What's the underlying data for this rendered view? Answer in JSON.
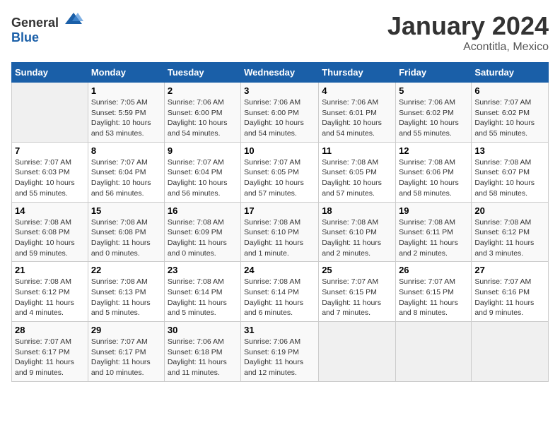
{
  "header": {
    "logo_general": "General",
    "logo_blue": "Blue",
    "month": "January 2024",
    "location": "Acontitla, Mexico"
  },
  "days_of_week": [
    "Sunday",
    "Monday",
    "Tuesday",
    "Wednesday",
    "Thursday",
    "Friday",
    "Saturday"
  ],
  "weeks": [
    [
      {
        "day": "",
        "info": ""
      },
      {
        "day": "1",
        "info": "Sunrise: 7:05 AM\nSunset: 5:59 PM\nDaylight: 10 hours\nand 53 minutes."
      },
      {
        "day": "2",
        "info": "Sunrise: 7:06 AM\nSunset: 6:00 PM\nDaylight: 10 hours\nand 54 minutes."
      },
      {
        "day": "3",
        "info": "Sunrise: 7:06 AM\nSunset: 6:00 PM\nDaylight: 10 hours\nand 54 minutes."
      },
      {
        "day": "4",
        "info": "Sunrise: 7:06 AM\nSunset: 6:01 PM\nDaylight: 10 hours\nand 54 minutes."
      },
      {
        "day": "5",
        "info": "Sunrise: 7:06 AM\nSunset: 6:02 PM\nDaylight: 10 hours\nand 55 minutes."
      },
      {
        "day": "6",
        "info": "Sunrise: 7:07 AM\nSunset: 6:02 PM\nDaylight: 10 hours\nand 55 minutes."
      }
    ],
    [
      {
        "day": "7",
        "info": "Sunrise: 7:07 AM\nSunset: 6:03 PM\nDaylight: 10 hours\nand 55 minutes."
      },
      {
        "day": "8",
        "info": "Sunrise: 7:07 AM\nSunset: 6:04 PM\nDaylight: 10 hours\nand 56 minutes."
      },
      {
        "day": "9",
        "info": "Sunrise: 7:07 AM\nSunset: 6:04 PM\nDaylight: 10 hours\nand 56 minutes."
      },
      {
        "day": "10",
        "info": "Sunrise: 7:07 AM\nSunset: 6:05 PM\nDaylight: 10 hours\nand 57 minutes."
      },
      {
        "day": "11",
        "info": "Sunrise: 7:08 AM\nSunset: 6:05 PM\nDaylight: 10 hours\nand 57 minutes."
      },
      {
        "day": "12",
        "info": "Sunrise: 7:08 AM\nSunset: 6:06 PM\nDaylight: 10 hours\nand 58 minutes."
      },
      {
        "day": "13",
        "info": "Sunrise: 7:08 AM\nSunset: 6:07 PM\nDaylight: 10 hours\nand 58 minutes."
      }
    ],
    [
      {
        "day": "14",
        "info": "Sunrise: 7:08 AM\nSunset: 6:08 PM\nDaylight: 10 hours\nand 59 minutes."
      },
      {
        "day": "15",
        "info": "Sunrise: 7:08 AM\nSunset: 6:08 PM\nDaylight: 11 hours\nand 0 minutes."
      },
      {
        "day": "16",
        "info": "Sunrise: 7:08 AM\nSunset: 6:09 PM\nDaylight: 11 hours\nand 0 minutes."
      },
      {
        "day": "17",
        "info": "Sunrise: 7:08 AM\nSunset: 6:10 PM\nDaylight: 11 hours\nand 1 minute."
      },
      {
        "day": "18",
        "info": "Sunrise: 7:08 AM\nSunset: 6:10 PM\nDaylight: 11 hours\nand 2 minutes."
      },
      {
        "day": "19",
        "info": "Sunrise: 7:08 AM\nSunset: 6:11 PM\nDaylight: 11 hours\nand 2 minutes."
      },
      {
        "day": "20",
        "info": "Sunrise: 7:08 AM\nSunset: 6:12 PM\nDaylight: 11 hours\nand 3 minutes."
      }
    ],
    [
      {
        "day": "21",
        "info": "Sunrise: 7:08 AM\nSunset: 6:12 PM\nDaylight: 11 hours\nand 4 minutes."
      },
      {
        "day": "22",
        "info": "Sunrise: 7:08 AM\nSunset: 6:13 PM\nDaylight: 11 hours\nand 5 minutes."
      },
      {
        "day": "23",
        "info": "Sunrise: 7:08 AM\nSunset: 6:14 PM\nDaylight: 11 hours\nand 5 minutes."
      },
      {
        "day": "24",
        "info": "Sunrise: 7:08 AM\nSunset: 6:14 PM\nDaylight: 11 hours\nand 6 minutes."
      },
      {
        "day": "25",
        "info": "Sunrise: 7:07 AM\nSunset: 6:15 PM\nDaylight: 11 hours\nand 7 minutes."
      },
      {
        "day": "26",
        "info": "Sunrise: 7:07 AM\nSunset: 6:15 PM\nDaylight: 11 hours\nand 8 minutes."
      },
      {
        "day": "27",
        "info": "Sunrise: 7:07 AM\nSunset: 6:16 PM\nDaylight: 11 hours\nand 9 minutes."
      }
    ],
    [
      {
        "day": "28",
        "info": "Sunrise: 7:07 AM\nSunset: 6:17 PM\nDaylight: 11 hours\nand 9 minutes."
      },
      {
        "day": "29",
        "info": "Sunrise: 7:07 AM\nSunset: 6:17 PM\nDaylight: 11 hours\nand 10 minutes."
      },
      {
        "day": "30",
        "info": "Sunrise: 7:06 AM\nSunset: 6:18 PM\nDaylight: 11 hours\nand 11 minutes."
      },
      {
        "day": "31",
        "info": "Sunrise: 7:06 AM\nSunset: 6:19 PM\nDaylight: 11 hours\nand 12 minutes."
      },
      {
        "day": "",
        "info": ""
      },
      {
        "day": "",
        "info": ""
      },
      {
        "day": "",
        "info": ""
      }
    ]
  ]
}
